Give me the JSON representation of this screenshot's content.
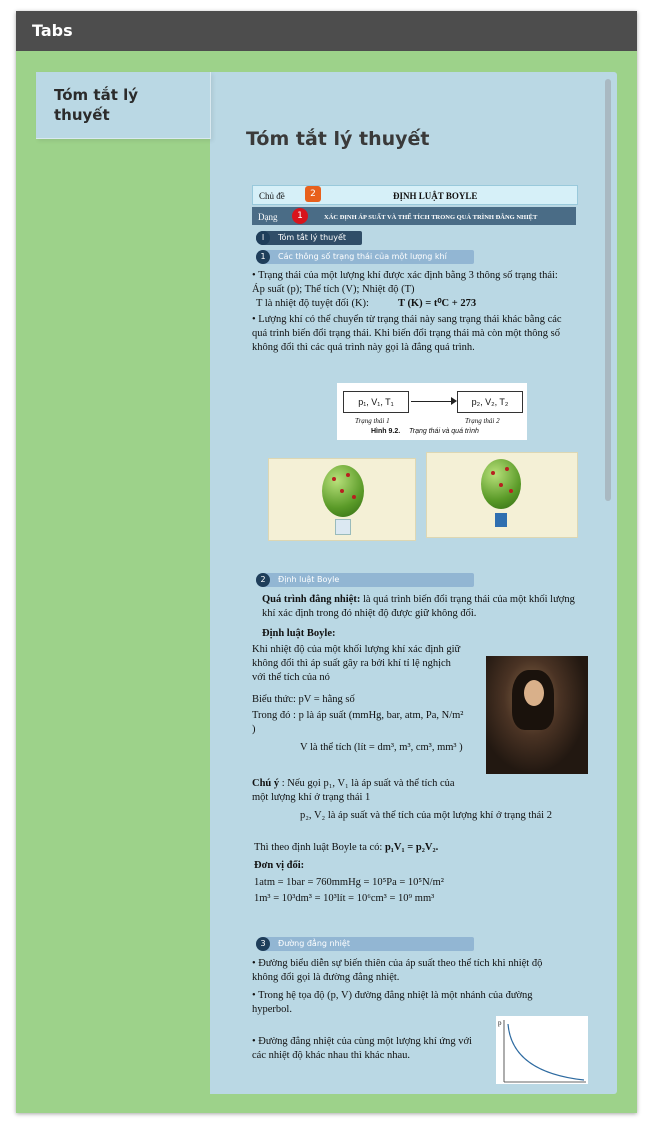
{
  "window": {
    "title": "Tabs"
  },
  "tabs": [
    {
      "label": "Tóm tắt lý thuyết"
    }
  ],
  "content": {
    "heading": "Tóm tắt lý thuyết",
    "doc": {
      "chu_de_label": "Chủ đề",
      "chu_de_num": "2",
      "chu_de_title": "ĐỊNH LUẬT BOYLE",
      "dang_label": "Dạng",
      "dang_num": "1",
      "dang_title": "XÁC ĐỊNH ÁP SUẤT VÀ THỂ TÍCH TRONG QUÁ TRÌNH ĐẲNG NHIỆT",
      "part_num": "I",
      "part_title": "Tóm tắt lý thuyết",
      "s1_num": "1",
      "s1_title": "Các thông số trạng thái của một lượng khí",
      "s1_p1": "• Trạng thái của một lượng khí được xác định bằng 3 thông số trạng thái: Áp suất (p); Thể tích (V); Nhiệt độ (T)",
      "s1_p2": "T là nhiệt độ tuyệt đối (K):",
      "s1_formula": "T (K) = t⁰C + 273",
      "s1_p3": "• Lượng khí có thể chuyển từ trạng thái này sang trạng thái khác bằng các quá trình biến đổi trạng thái. Khi biến đổi trạng thái mà còn một thông số không đổi thì các quá trình này gọi là đẳng quá trình.",
      "fig_state1": "p₁, V₁, T₁",
      "fig_state2": "p₂, V₂, T₂",
      "fig_label1": "Trạng thái 1",
      "fig_label2": "Trạng thái 2",
      "fig_caption_bold": "Hình 9.2.",
      "fig_caption": "Trạng thái và quá trình",
      "s2_num": "2",
      "s2_title": "Định luật Boyle",
      "s2_p1_bold": "Quá trình đẳng nhiệt:",
      "s2_p1": "là quá trình biến đổi trạng thái của một khối lượng khí xác định trong đó nhiệt độ được giữ không đổi.",
      "s2_p2_bold": "Định luật Boyle:",
      "s2_p3": "Khi nhiệt độ của một khối lượng khí xác định giữ không đổi thì áp suất gây ra bởi khí tỉ lệ nghịch với thể tích của nó",
      "s2_p4": "Biểu thức:   pV = hằng số",
      "s2_p5": "Trong đó : p là áp suất (mmHg, bar, atm, Pa, N/m² )",
      "s2_p6": "V là thể tích (lít = dm³, m³, cm³, mm³ )",
      "s2_p7_bold": "Chú ý",
      "s2_p7": ": Nếu gọi p₁, V₁ là áp suất và thể tích của một lượng khí ở trạng thái 1",
      "s2_p8": "p₂, V₂ là áp suất và thể tích của một lượng khí ở trạng thái 2",
      "s2_p9": "Thì theo định luật Boyle ta có:",
      "s2_p9_formula": "p₁V₁ = p₂V₂.",
      "s2_units_title": "Đơn vị đổi:",
      "s2_units1": "1atm = 1bar  = 760mmHg  = 10⁵Pa   = 10⁵N/m²",
      "s2_units2": "1m³ = 10³dm³  = 10³lít  = 10⁶cm³ = 10⁹ mm³",
      "s3_num": "3",
      "s3_title": "Đường đẳng nhiệt",
      "s3_p1": "• Đường biểu diễn sự biến thiên của áp suất theo thể tích khi nhiệt độ không đổi gọi là đường đẳng nhiệt.",
      "s3_p2": "• Trong hệ tọa độ (p, V) đường đẳng nhiệt là một nhánh của đường hyperbol.",
      "s3_p3": "• Đường đẳng nhiệt của cùng một lượng khí ứng với các nhiệt độ khác nhau thì khác nhau.",
      "graph_p": "p"
    }
  }
}
